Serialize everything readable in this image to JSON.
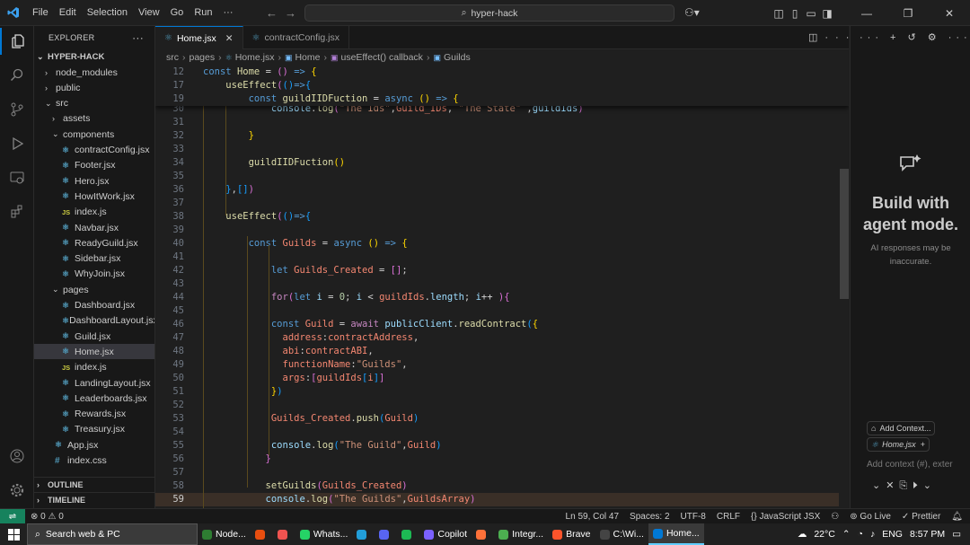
{
  "titlebar": {
    "menu": [
      "File",
      "Edit",
      "Selection",
      "View",
      "Go",
      "Run",
      "···"
    ],
    "search": "hyper-hack"
  },
  "sidebar": {
    "header": "EXPLORER",
    "project": "HYPER-HACK",
    "items": [
      {
        "label": "node_modules",
        "type": "folder",
        "open": false,
        "depth": 1
      },
      {
        "label": "public",
        "type": "folder",
        "open": false,
        "depth": 1
      },
      {
        "label": "src",
        "type": "folder",
        "open": true,
        "depth": 1
      },
      {
        "label": "assets",
        "type": "folder",
        "open": false,
        "depth": 2
      },
      {
        "label": "components",
        "type": "folder",
        "open": true,
        "depth": 2
      },
      {
        "label": "contractConfig.jsx",
        "type": "react",
        "depth": 3
      },
      {
        "label": "Footer.jsx",
        "type": "react",
        "depth": 3
      },
      {
        "label": "Hero.jsx",
        "type": "react",
        "depth": 3
      },
      {
        "label": "HowItWork.jsx",
        "type": "react",
        "depth": 3
      },
      {
        "label": "index.js",
        "type": "js",
        "depth": 3
      },
      {
        "label": "Navbar.jsx",
        "type": "react",
        "depth": 3
      },
      {
        "label": "ReadyGuild.jsx",
        "type": "react",
        "depth": 3
      },
      {
        "label": "Sidebar.jsx",
        "type": "react",
        "depth": 3
      },
      {
        "label": "WhyJoin.jsx",
        "type": "react",
        "depth": 3
      },
      {
        "label": "pages",
        "type": "folder",
        "open": true,
        "depth": 2
      },
      {
        "label": "Dashboard.jsx",
        "type": "react",
        "depth": 3
      },
      {
        "label": "DashboardLayout.jsx",
        "type": "react",
        "depth": 3
      },
      {
        "label": "Guild.jsx",
        "type": "react",
        "depth": 3
      },
      {
        "label": "Home.jsx",
        "type": "react",
        "depth": 3,
        "selected": true
      },
      {
        "label": "index.js",
        "type": "js",
        "depth": 3
      },
      {
        "label": "LandingLayout.jsx",
        "type": "react",
        "depth": 3
      },
      {
        "label": "Leaderboards.jsx",
        "type": "react",
        "depth": 3
      },
      {
        "label": "Rewards.jsx",
        "type": "react",
        "depth": 3
      },
      {
        "label": "Treasury.jsx",
        "type": "react",
        "depth": 3
      },
      {
        "label": "App.jsx",
        "type": "react",
        "depth": 2
      },
      {
        "label": "index.css",
        "type": "css",
        "depth": 2
      }
    ],
    "outline": "OUTLINE",
    "timeline": "TIMELINE"
  },
  "tabs": [
    {
      "label": "Home.jsx",
      "active": true
    },
    {
      "label": "contractConfig.jsx",
      "active": false
    }
  ],
  "breadcrumb": [
    "src",
    "pages",
    "Home.jsx",
    "Home",
    "useEffect() callback",
    "Guilds"
  ],
  "editor": {
    "sticky": [
      {
        "n": "12",
        "html": "<span class='kw'>const</span> <span class='fn'>Home</span> <span class='pl'>=</span> <span class='br2'>()</span> <span class='kw'>=&gt;</span> <span class='br1'>{</span>"
      },
      {
        "n": "17",
        "html": "    <span class='fn'>useEffect</span><span class='br2'>(</span><span class='br3'>()</span><span class='kw'>=&gt;</span><span class='br3'>{</span>"
      },
      {
        "n": "19",
        "html": "        <span class='kw'>const</span> <span class='fn'>guildIIDFuction</span> <span class='pl'>=</span> <span class='kw'>async</span> <span class='br1'>()</span> <span class='kw'>=&gt;</span> <span class='br1'>{</span>"
      }
    ],
    "lines": [
      {
        "n": "30",
        "html": "            <span class='var'>console</span>.<span class='fn'>log</span><span class='br2'>(</span><span class='str'>\"The Ids\"</span>,<span class='vr'>Guild_IDs</span>, <span class='str'>\"The State\"</span> ,<span class='var'>guildIds</span><span class='br2'>)</span>"
      },
      {
        "n": "31",
        "html": ""
      },
      {
        "n": "32",
        "html": "        <span class='br1'>}</span>"
      },
      {
        "n": "33",
        "html": ""
      },
      {
        "n": "34",
        "html": "        <span class='fn'>guildIIDFuction</span><span class='br1'>()</span>"
      },
      {
        "n": "35",
        "html": ""
      },
      {
        "n": "36",
        "html": "    <span class='br3'>}</span>,<span class='br3'>[]</span><span class='br2'>)</span>"
      },
      {
        "n": "37",
        "html": ""
      },
      {
        "n": "38",
        "html": "    <span class='fn'>useEffect</span><span class='br2'>(</span><span class='br3'>()</span><span class='kw'>=&gt;</span><span class='br3'>{</span>"
      },
      {
        "n": "39",
        "html": ""
      },
      {
        "n": "40",
        "html": "        <span class='kw'>const</span> <span class='vr'>Guilds</span> <span class='pl'>=</span> <span class='kw'>async</span> <span class='br1'>()</span> <span class='kw'>=&gt;</span> <span class='br1'>{</span>"
      },
      {
        "n": "41",
        "html": ""
      },
      {
        "n": "42",
        "html": "            <span class='kw'>let</span> <span class='vr'>Guilds_Created</span> <span class='pl'>=</span> <span class='br2'>[]</span>;"
      },
      {
        "n": "43",
        "html": ""
      },
      {
        "n": "44",
        "html": "            <span class='ctl'>for</span><span class='br2'>(</span><span class='kw'>let</span> <span class='var'>i</span> <span class='pl'>=</span> <span class='num'>0</span>; <span class='var'>i</span> <span class='pl'>&lt;</span> <span class='vr'>guildIds</span>.<span class='var'>length</span>; <span class='var'>i</span><span class='pl'>++</span> <span class='br2'>)</span><span class='br2'>{</span>"
      },
      {
        "n": "45",
        "html": ""
      },
      {
        "n": "46",
        "html": "            <span class='kw'>const</span> <span class='vr'>Guild</span> <span class='pl'>=</span> <span class='ctl'>await</span> <span class='var'>publicClient</span>.<span class='fn'>readContract</span><span class='br3'>(</span><span class='br1'>{</span>"
      },
      {
        "n": "47",
        "html": "              <span class='vr'>address</span>:<span class='vr'>contractAddress</span>,"
      },
      {
        "n": "48",
        "html": "              <span class='vr'>abi</span>:<span class='vr'>contractABI</span>,"
      },
      {
        "n": "49",
        "html": "              <span class='vr'>functionName</span>:<span class='str'>\"Guilds\"</span>,"
      },
      {
        "n": "50",
        "html": "              <span class='vr'>args</span>:<span class='br2'>[</span><span class='vr'>guildIds</span><span class='br3'>[</span><span class='vr'>i</span><span class='br3'>]</span><span class='br2'>]</span>"
      },
      {
        "n": "51",
        "html": "            <span class='br1'>}</span><span class='br3'>)</span>"
      },
      {
        "n": "52",
        "html": ""
      },
      {
        "n": "53",
        "html": "            <span class='vr'>Guilds_Created</span>.<span class='fn'>push</span><span class='br3'>(</span><span class='vr'>Guild</span><span class='br3'>)</span>"
      },
      {
        "n": "54",
        "html": ""
      },
      {
        "n": "55",
        "html": "            <span class='var'>console</span>.<span class='fn'>log</span><span class='br3'>(</span><span class='str'>\"The Guild\"</span>,<span class='vr'>Guild</span><span class='br3'>)</span>"
      },
      {
        "n": "56",
        "html": "           <span class='br2'>}</span>"
      },
      {
        "n": "57",
        "html": ""
      },
      {
        "n": "58",
        "html": "           <span class='fn'>setGuilds</span><span class='br2'>(</span><span class='vr'>Guilds_Created</span><span class='br2'>)</span>"
      },
      {
        "n": "59",
        "html": "           <span class='var'>console</span>.<span class='fn'>log</span><span class='br2'>(</span><span class='str'>\"The Guilds\"</span>,<span class='vr'>GuildsArray</span><span class='br2'>)</span>",
        "current": true
      }
    ]
  },
  "chat": {
    "title": "Build with agent mode.",
    "subtitle": "AI responses may be inaccurate.",
    "add_context": "Add Context...",
    "file_chip": "Home.jsx",
    "input_placeholder": "Add context (#), exter"
  },
  "status": {
    "errors": "0",
    "warnings": "0",
    "position": "Ln 59, Col 47",
    "spaces": "Spaces: 2",
    "encoding": "UTF-8",
    "eol": "CRLF",
    "language": "JavaScript JSX",
    "golive": "Go Live",
    "prettier": "Prettier"
  },
  "taskbar": {
    "search": "Search web & PC",
    "apps": [
      "Node...",
      "",
      "",
      "Whats...",
      "",
      "",
      "",
      "Copilot",
      "",
      "Integr...",
      "Brave",
      "C:\\Wi...",
      "Home..."
    ],
    "temp": "22°C",
    "lang": "ENG",
    "time": "8:57 PM"
  },
  "colors": {
    "accent": "#0078d4",
    "remote": "#16825d",
    "cursor_line": "#3a2f27"
  }
}
